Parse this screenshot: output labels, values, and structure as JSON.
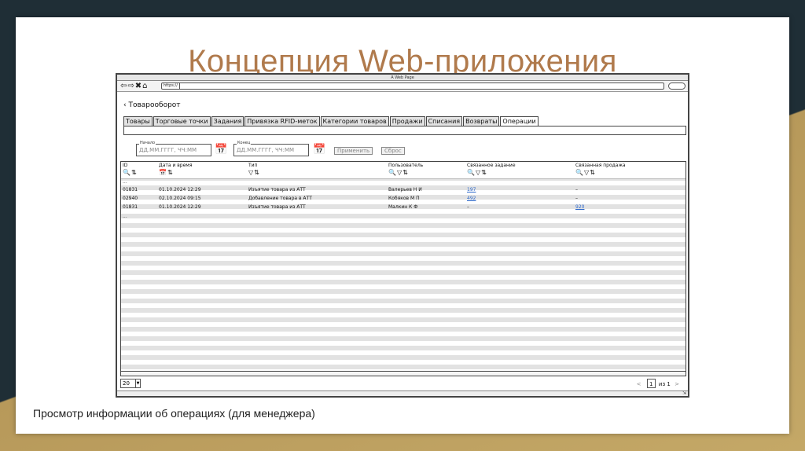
{
  "slide": {
    "title": "Концепция Web-приложения",
    "caption": "Просмотр информации об операциях (для менеджера)"
  },
  "browser": {
    "window_title": "A Web Page",
    "nav_icons": "⇦⇨✖⌂",
    "address": "https://"
  },
  "page": {
    "back_icon": "chevron-left-icon",
    "title": "Товарооборот",
    "tabs": [
      {
        "label": "Товары"
      },
      {
        "label": "Торговые точки"
      },
      {
        "label": "Задания"
      },
      {
        "label": "Привязка RFID-меток"
      },
      {
        "label": "Категории товаров"
      },
      {
        "label": "Продажи"
      },
      {
        "label": "Списания"
      },
      {
        "label": "Возвраты"
      },
      {
        "label": "Операции",
        "active": true
      }
    ],
    "filters": {
      "start_label": "Начало",
      "start_placeholder": "ДД.ММ.ГГГГ, ЧЧ:ММ",
      "end_label": "Конец",
      "end_placeholder": "ДД.ММ.ГГГГ, ЧЧ:ММ",
      "apply_label": "Применить",
      "reset_label": "Сброс"
    }
  },
  "grid": {
    "columns": [
      {
        "label": "ID",
        "tools": "🔍⇅"
      },
      {
        "label": "Дата и время",
        "tools": "📅⇅"
      },
      {
        "label": "Тип",
        "tools": "▽⇅"
      },
      {
        "label": "Пользователь",
        "tools": "🔍▽⇅"
      },
      {
        "label": "Связанное задание",
        "tools": "🔍▽⇅"
      },
      {
        "label": "Связанная продажа",
        "tools": "🔍▽⇅"
      }
    ],
    "ellipsis": "...",
    "rows": [
      [
        "01831",
        "01.10.2024 12:29",
        "Изъятие товара из АТТ",
        "Валерьев Н И",
        "197",
        "–"
      ],
      [
        "02940",
        "02.10.2024 09:15",
        "Добавление товара в АТТ",
        "Кобяков М П",
        "492",
        "–"
      ],
      [
        "01831",
        "01.10.2024 12:29",
        "Изъятие товара из АТТ",
        "Малкин К Ф",
        "–",
        "920"
      ]
    ]
  },
  "pager": {
    "page_size": "20",
    "current_page": "1",
    "of_label": "из",
    "total_pages": "1",
    "prev": "<",
    "next": ">"
  },
  "colors": {
    "title": "#b07a4c",
    "link": "#2a66c9",
    "background": "#1f2e36",
    "gold": "#c4a867"
  }
}
